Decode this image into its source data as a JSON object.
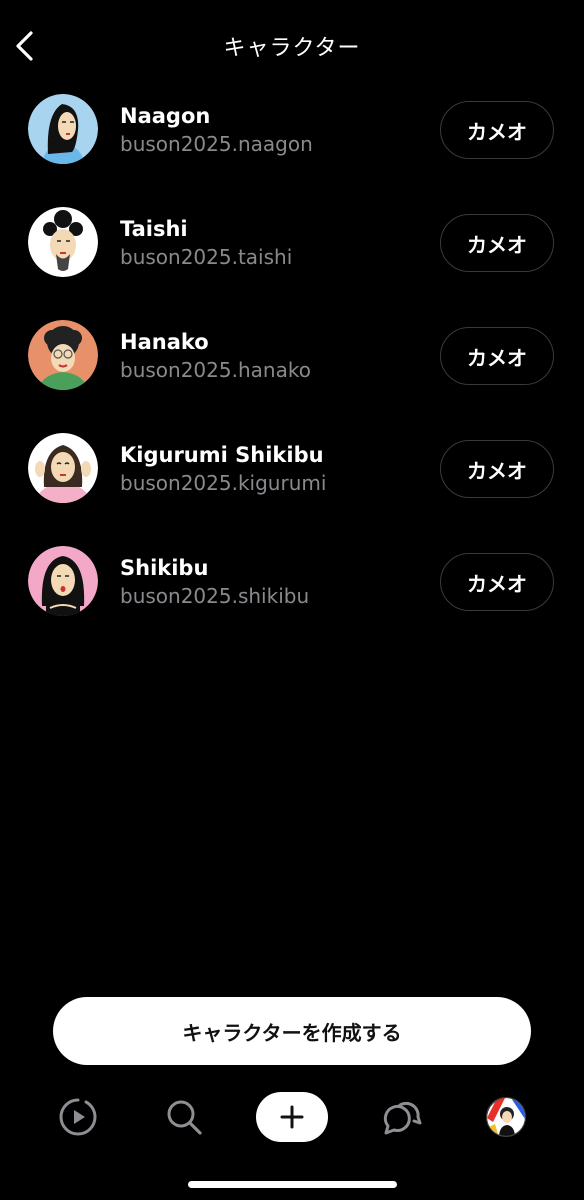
{
  "header": {
    "title": "キャラクター",
    "back_icon": "chevron-left-icon"
  },
  "characters": [
    {
      "name": "Naagon",
      "handle": "buson2025.naagon",
      "button": "カメオ",
      "avatar_bg": "#a8d4f0"
    },
    {
      "name": "Taishi",
      "handle": "buson2025.taishi",
      "button": "カメオ",
      "avatar_bg": "#ffffff"
    },
    {
      "name": "Hanako",
      "handle": "buson2025.hanako",
      "button": "カメオ",
      "avatar_bg": "#e8906a"
    },
    {
      "name": "Kigurumi Shikibu",
      "handle": "buson2025.kigurumi",
      "button": "カメオ",
      "avatar_bg": "#ffffff"
    },
    {
      "name": "Shikibu",
      "handle": "buson2025.shikibu",
      "button": "カメオ",
      "avatar_bg": "#f4a8c8"
    }
  ],
  "create_button": {
    "label": "キャラクターを作成する"
  },
  "tabbar": {
    "items": [
      "play-icon",
      "search-icon",
      "plus-icon",
      "messages-icon",
      "profile-avatar"
    ]
  },
  "colors": {
    "background": "#000000",
    "text": "#ffffff",
    "secondary_text": "#8a8a8e",
    "button_border": "#3a3a3c"
  }
}
